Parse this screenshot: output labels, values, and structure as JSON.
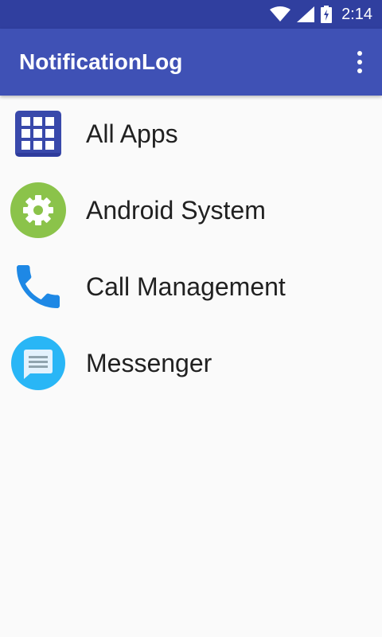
{
  "status_bar": {
    "time": "2:14",
    "icons": [
      "wifi-icon",
      "cell-signal-icon",
      "battery-charging-icon"
    ]
  },
  "app_bar": {
    "title": "NotificationLog",
    "overflow_icon": "more-vert-icon"
  },
  "apps": [
    {
      "label": "All Apps",
      "icon": "grid-apps-icon"
    },
    {
      "label": "Android System",
      "icon": "settings-gear-icon"
    },
    {
      "label": "Call Management",
      "icon": "phone-icon"
    },
    {
      "label": "Messenger",
      "icon": "messenger-icon"
    }
  ],
  "colors": {
    "status_bar": "#303f9f",
    "app_bar": "#3f51b5",
    "background": "#fafafa"
  }
}
